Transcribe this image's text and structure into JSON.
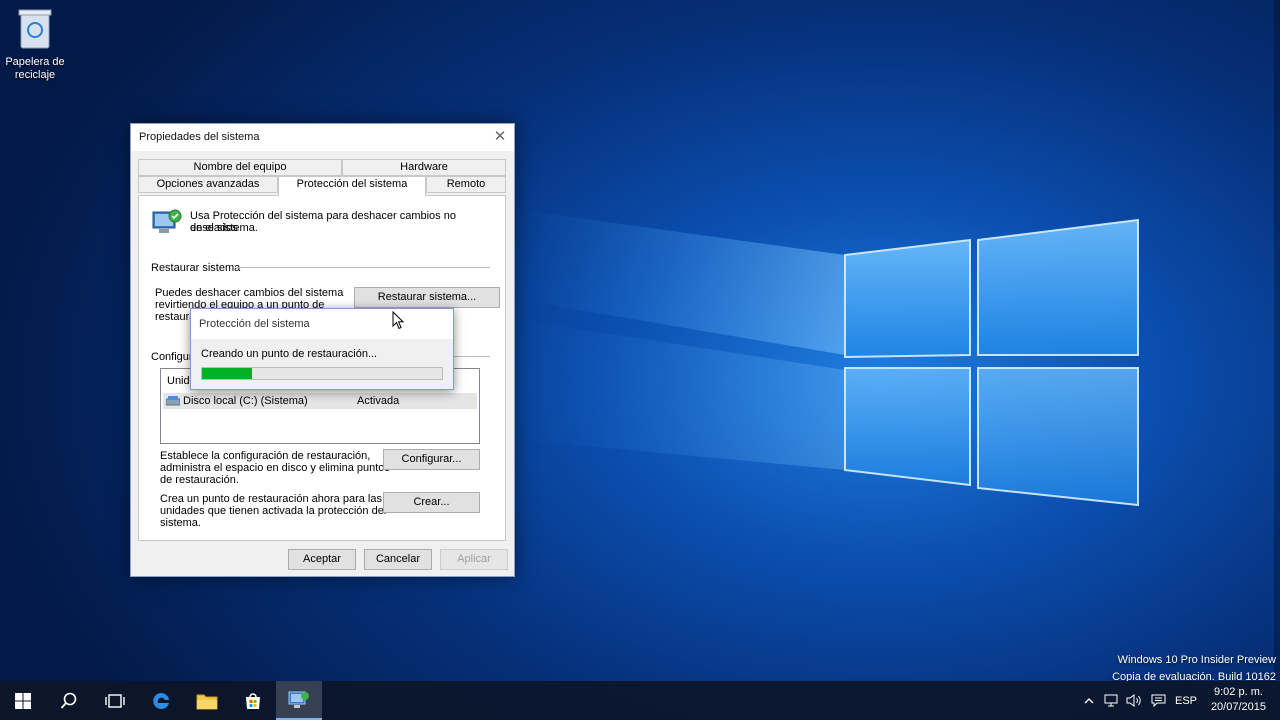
{
  "desktop": {
    "recycle_bin_label_1": "Papelera de",
    "recycle_bin_label_2": "reciclaje"
  },
  "dialog": {
    "title": "Propiedades del sistema",
    "close_glyph": "✕",
    "tabs_row1": [
      "Nombre del equipo",
      "Hardware"
    ],
    "tabs_row2": [
      "Opciones avanzadas",
      "Protección del sistema",
      "Remoto"
    ],
    "active_tab": "Protección del sistema",
    "intro_line1": "Usa Protección del sistema para deshacer cambios no deseados",
    "intro_line2": "en el sistema.",
    "restore_group": "Restaurar sistema",
    "restore_text_1": "Puedes deshacer cambios del sistema",
    "restore_text_2": "revirtiendo el equipo a un punto de",
    "restore_text_3": "restaura",
    "restore_button": "Restaurar sistema...",
    "config_group": "Configura",
    "list_header": "Unida",
    "list_rows": [
      {
        "drive": "Disco local (C:) (Sistema)",
        "status": "Activada"
      }
    ],
    "configure_text_1": "Establece la configuración de restauración,",
    "configure_text_2": "administra el espacio en disco y elimina puntos",
    "configure_text_3": "de restauración.",
    "configure_button": "Configurar...",
    "create_text_1": "Crea un punto de restauración ahora para las",
    "create_text_2": "unidades que tienen activada la protección del",
    "create_text_3": "sistema.",
    "create_button": "Crear...",
    "ok_button": "Aceptar",
    "cancel_button": "Cancelar",
    "apply_button": "Aplicar"
  },
  "progress_popup": {
    "title": "Protección del sistema",
    "message": "Creando un punto de restauración...",
    "progress": 0.21,
    "fill_color": "#06b025"
  },
  "watermark": {
    "line1": "Windows 10 Pro Insider Preview",
    "line2": "Copia de evaluación. Build 10162"
  },
  "taskbar": {
    "items": [
      "windows-start-icon",
      "search-icon",
      "task-view-icon",
      "edge-icon",
      "file-explorer-icon",
      "store-icon",
      "system-properties-icon"
    ],
    "language": "ESP",
    "time": "9:02 p. m.",
    "date": "20/07/2015"
  }
}
